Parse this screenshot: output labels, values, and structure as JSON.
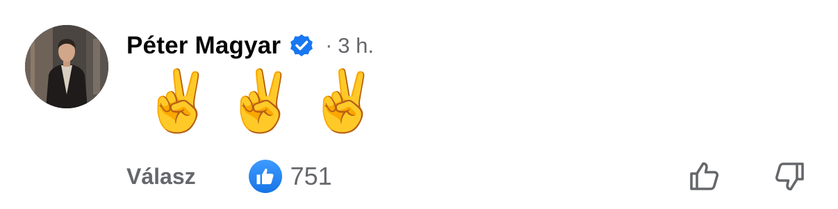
{
  "comment": {
    "author_name": "Péter Magyar",
    "separator": "·",
    "timestamp": "3 h.",
    "verified_icon": "verified-badge-icon",
    "body_text": "✌️✌️✌️",
    "reply_label": "Válasz",
    "reaction_icon": "thumbs-up-icon",
    "reaction_count": "751",
    "like_icon": "thumbs-up-outline-icon",
    "dislike_icon": "thumbs-down-outline-icon"
  },
  "colors": {
    "verified_blue": "#1877f2",
    "muted_text": "#65676b",
    "primary_text": "#050505",
    "reaction_blue": "#1877f2"
  }
}
